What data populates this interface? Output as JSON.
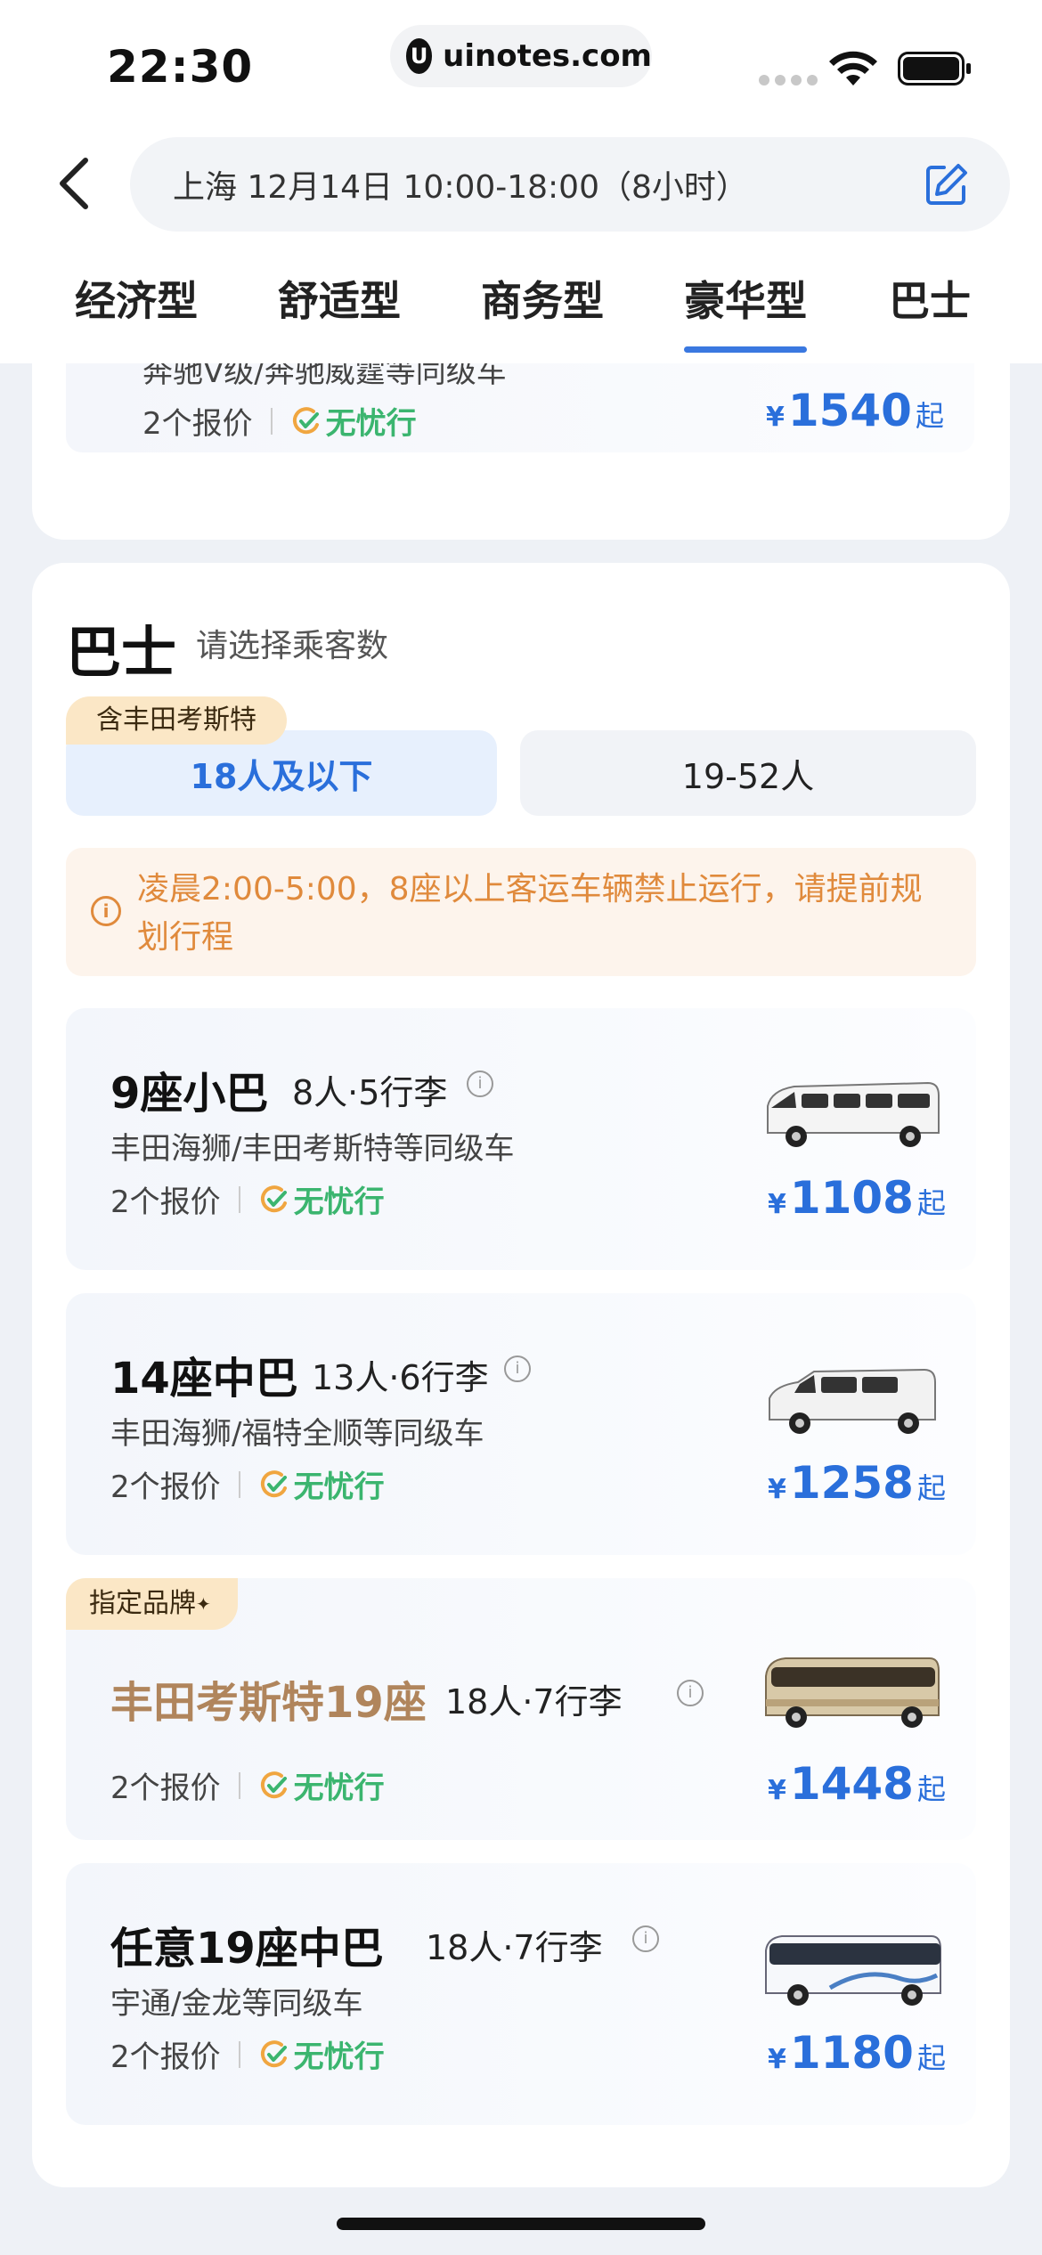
{
  "status_bar": {
    "time": "22:30",
    "url_badge_icon": "U",
    "url": "uinotes.com",
    "icons": [
      "signal-icon",
      "wifi-icon",
      "battery-icon"
    ]
  },
  "nav": {
    "back_icon": "chevron-left-icon",
    "search_text": "上海 12月14日 10:00-18:00（8小时）",
    "edit_icon": "edit-icon"
  },
  "tabs": [
    {
      "label": "经济型",
      "active": false
    },
    {
      "label": "舒适型",
      "active": false
    },
    {
      "label": "商务型",
      "active": false
    },
    {
      "label": "豪华型",
      "active": true
    },
    {
      "label": "巴士",
      "active": false
    }
  ],
  "luxury_partial": {
    "models": "奔驰Ⅴ级/奔驰威霆等同级车",
    "quotes": "2个报价",
    "worry_free": "无忧行",
    "currency": "¥",
    "price": "1540",
    "suffix": "起"
  },
  "bus_section": {
    "title": "巴士",
    "subtitle": "请选择乘客数",
    "seg_tag": "含丰田考斯特",
    "seg_left": "18人及以下",
    "seg_right": "19-52人",
    "notice_icon": "i",
    "notice": "凌晨2:00-5:00，8座以上客运车辆禁止运行，请提前规划行程"
  },
  "vehicles": [
    {
      "name": "9座小巴",
      "capacity": "8人·5行李",
      "models": "丰田海狮/丰田考斯特等同级车",
      "quotes": "2个报价",
      "worry_free": "无忧行",
      "currency": "¥",
      "price": "1108",
      "suffix": "起"
    },
    {
      "name": "14座中巴",
      "capacity": "13人·6行李",
      "models": "丰田海狮/福特全顺等同级车",
      "quotes": "2个报价",
      "worry_free": "无忧行",
      "currency": "¥",
      "price": "1258",
      "suffix": "起"
    },
    {
      "brand_tag": "指定品牌",
      "name": "丰田考斯特19座",
      "capacity": "18人·7行李",
      "quotes": "2个报价",
      "worry_free": "无忧行",
      "currency": "¥",
      "price": "1448",
      "suffix": "起"
    },
    {
      "name": "任意19座中巴",
      "capacity": "18人·7行李",
      "models": "宇通/金龙等同级车",
      "quotes": "2个报价",
      "worry_free": "无忧行",
      "currency": "¥",
      "price": "1180",
      "suffix": "起"
    }
  ],
  "colors": {
    "accent": "#2a6fdb",
    "worry_free": "#3bb56f",
    "brand_name": "#b0855c",
    "notice": "#e08a3c",
    "tag_bg": "#fbe7c6"
  }
}
